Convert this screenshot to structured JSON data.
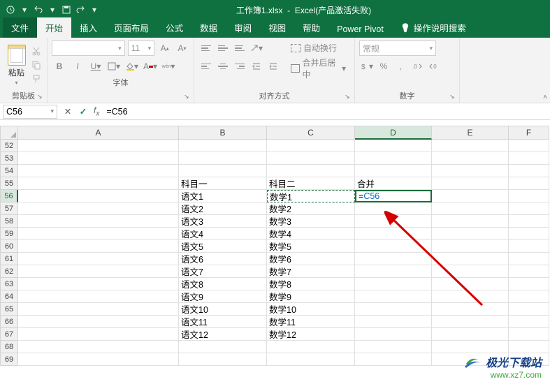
{
  "titlebar": {
    "doc": "工作簿1.xlsx",
    "app": "Excel(产品激活失败)"
  },
  "tabs": {
    "file": "文件",
    "home": "开始",
    "insert": "插入",
    "layout": "页面布局",
    "formula": "公式",
    "data": "数据",
    "review": "审阅",
    "view": "视图",
    "help": "帮助",
    "pivot": "Power Pivot",
    "search": "操作说明搜索"
  },
  "ribbon": {
    "clipboard": {
      "paste": "粘贴",
      "group": "剪贴板"
    },
    "font": {
      "group": "字体",
      "sizePlaceholder": "11",
      "B": "B",
      "I": "I",
      "U": "U"
    },
    "align": {
      "group": "对齐方式",
      "wrap": "自动换行",
      "merge": "合并后居中"
    },
    "number": {
      "group": "数字",
      "general": "常规"
    }
  },
  "fbar": {
    "name": "C56",
    "cancel": "✕",
    "enter": "✓",
    "formula": "=C56"
  },
  "columns": [
    "A",
    "B",
    "C",
    "D",
    "E",
    "F"
  ],
  "rows": [
    "52",
    "53",
    "54",
    "55",
    "56",
    "57",
    "58",
    "59",
    "60",
    "61",
    "62",
    "63",
    "64",
    "65",
    "66",
    "67",
    "68",
    "69"
  ],
  "sheet": {
    "B55": "科目一",
    "C55": "科目二",
    "D55": "合并",
    "B56": "语文1",
    "C56": "数学1",
    "D56_prefix": "=",
    "D56_ref": "C56",
    "B57": "语文2",
    "C57": "数学2",
    "B58": "语文3",
    "C58": "数学3",
    "B59": "语文4",
    "C59": "数学4",
    "B60": "语文5",
    "C60": "数学5",
    "B61": "语文6",
    "C61": "数学6",
    "B62": "语文7",
    "C62": "数学7",
    "B63": "语文8",
    "C63": "数学8",
    "B64": "语文9",
    "C64": "数学9",
    "B65": "语文10",
    "C65": "数学10",
    "B66": "语文11",
    "C66": "数学11",
    "B67": "语文12",
    "C67": "数学12"
  },
  "watermark": {
    "title": "极光下载站",
    "url": "www.xz7.com"
  }
}
